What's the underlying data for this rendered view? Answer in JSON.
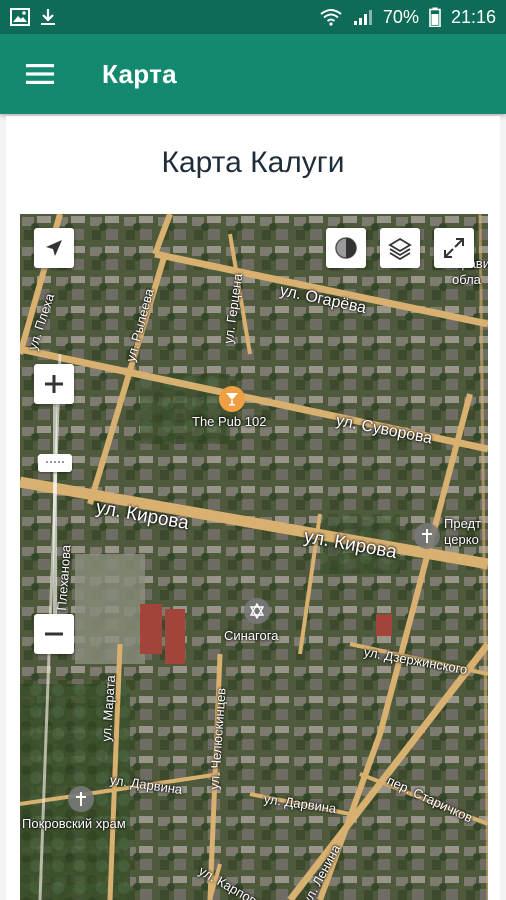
{
  "status_bar": {
    "battery": "70%",
    "time": "21:16"
  },
  "app_bar": {
    "title": "Карта"
  },
  "page": {
    "title": "Карта Калуги"
  },
  "map": {
    "streets": [
      {
        "key": "ogareva",
        "text": "ул. Огарёва"
      },
      {
        "key": "suvorova",
        "text": "ул. Суворова"
      },
      {
        "key": "kirova1",
        "text": "ул. Кирова"
      },
      {
        "key": "kirova2",
        "text": "ул. Кирова"
      },
      {
        "key": "dzerzhinskogo",
        "text": "ул. Дзержинского"
      },
      {
        "key": "darvina1",
        "text": "ул. Дарвина"
      },
      {
        "key": "darvina2",
        "text": "ул. Дарвина"
      },
      {
        "key": "starichkov",
        "text": "пер. Старичков"
      },
      {
        "key": "lenina",
        "text": "ул. Ленина"
      },
      {
        "key": "karpova",
        "text": "ул. Карпова"
      },
      {
        "key": "plekhanova",
        "text": "ул. Плеха"
      },
      {
        "key": "rylsk",
        "text": "ул. Рылеева"
      },
      {
        "key": "trudova",
        "text": "ул. Герцена"
      },
      {
        "key": "marata",
        "text": "ул. Марата"
      },
      {
        "key": "chelyuskin",
        "text": "ул. Челюскинцев"
      },
      {
        "key": "salesa",
        "text": "ул. Плеханова"
      }
    ],
    "places": {
      "pub": "The Pub 102",
      "synagogue": "Синагога",
      "church": "Покровский храм",
      "church2": "Предт\nцерко",
      "govt": "Правит\nобла"
    },
    "controls": {
      "my_location": "location-arrow-icon",
      "theme": "contrast-icon",
      "layers": "layers-icon",
      "fullscreen": "fullscreen-icon",
      "zoom_in": "plus-icon",
      "zoom_out": "minus-icon"
    }
  }
}
